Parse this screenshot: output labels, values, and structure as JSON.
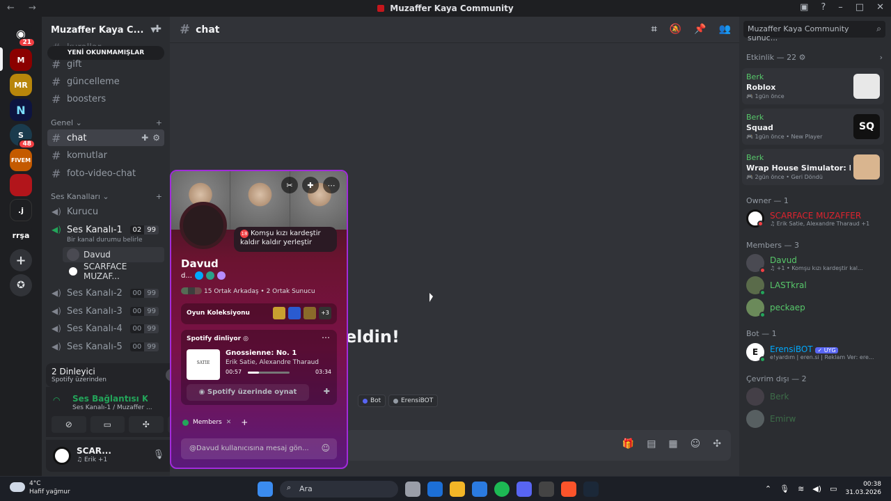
{
  "window": {
    "title": "Muzaffer Kaya Community",
    "nav": "← →"
  },
  "guilds": [
    {
      "label": "",
      "badge": "21",
      "color": "#1e1f22",
      "glyph": "🎮"
    },
    {
      "label": "M",
      "badge": "",
      "color": "#8b0000"
    },
    {
      "label": "MR",
      "badge": "",
      "color": "#b8860b"
    },
    {
      "label": "N",
      "badge": "",
      "color": "#0d1440"
    },
    {
      "label": "S",
      "badge": "48",
      "color": "#1a3b4d"
    },
    {
      "label": "FIVEM",
      "badge": "",
      "color": "#c45a00"
    },
    {
      "label": "",
      "badge": "",
      "color": "#b2151b"
    },
    {
      "label": ".j",
      "badge": "",
      "color": "#1e1f22"
    },
    {
      "label": "rrşa",
      "badge": "",
      "color": "#1e1f22"
    }
  ],
  "server": {
    "name": "Muzaffer Kaya C...",
    "unread": "YENİ OKUNMAMIŞLAR"
  },
  "channels_top": [
    "kurallar",
    "gift",
    "güncelleme",
    "boosters"
  ],
  "category_general": "Genel",
  "channels_general": [
    "chat",
    "komutlar",
    "foto-video-chat"
  ],
  "category_voice": "Ses Kanalları",
  "voice": [
    {
      "name": "Kurucu"
    },
    {
      "name": "Ses Kanalı-1",
      "count": "02",
      "max": "99",
      "status": "Bir kanal durumu belirle"
    },
    {
      "name": "Ses Kanalı-2",
      "count": "00",
      "max": "99"
    },
    {
      "name": "Ses Kanalı-3",
      "count": "00",
      "max": "99"
    },
    {
      "name": "Ses Kanalı-4",
      "count": "00",
      "max": "99"
    },
    {
      "name": "Ses Kanalı-5",
      "count": "00",
      "max": "99"
    }
  ],
  "voice_users": [
    "Davud",
    "SCARFACE MUZAF..."
  ],
  "listeners": {
    "title": "2 Dinleyici",
    "sub": "Spotify üzerinden"
  },
  "connection": {
    "title": "Ses Bağlantısı Kurul",
    "sub": "Ses Kanalı-1 / Muzaffer ..."
  },
  "user": {
    "name": "SCAR...",
    "status": "Erik",
    "extra": "+1"
  },
  "channel_header": {
    "name": "chat",
    "search": "Muzaffer Kaya Community sunuc..."
  },
  "welcome": "eldin!",
  "tags": [
    {
      "label": "Bot",
      "color": "#5865f2"
    },
    {
      "label": "ErensiBOT",
      "color": "#949ba4"
    }
  ],
  "activity": {
    "header": "Etkinlik — 22",
    "items": [
      {
        "user": "Berk",
        "game": "Roblox",
        "meta": "1gün önce",
        "extra": ""
      },
      {
        "user": "Berk",
        "game": "Squad",
        "meta": "1gün önce",
        "extra": "New Player"
      },
      {
        "user": "Berk",
        "game": "Wrap House Simulator: Pro...",
        "meta": "2gün önce",
        "extra": "Geri Döndü"
      }
    ]
  },
  "groups": {
    "owner": "Owner — 1",
    "members": "Members — 3",
    "bot": "Bot — 1",
    "offline": "Çevrim dışı — 2"
  },
  "owner": {
    "name": "SCARFACE MUZAFFER",
    "sub": "Erik Satie, Alexandre Tharaud +1"
  },
  "member_list": [
    {
      "name": "Davud",
      "sub": "+1 • Komşu kızı kardeştir kal...",
      "color": "#57c86a"
    },
    {
      "name": "LASTkral",
      "sub": "",
      "color": "#57c86a"
    },
    {
      "name": "peckaep",
      "sub": "",
      "color": "#57c86a"
    }
  ],
  "bot": {
    "name": "ErensiBOT",
    "badge": "✓ UYG",
    "sub": "e!yardım | eren.si | Reklam Ver: ere..."
  },
  "offline_list": [
    "Berk",
    "Emirw"
  ],
  "popout": {
    "name": "Davud",
    "tag": "d...",
    "bubble_n": "18",
    "bubble": "Komşu kızı kardeştir kaldır kaldır yerleştir",
    "mutual": "15 Ortak Arkadaş • 2 Ortak Sunucu",
    "games_label": "Oyun Koleksiyonu",
    "games_more": "+3",
    "spotify_label": "Spotify dinliyor",
    "track": "Gnossienne: No. 1",
    "artist": "Erik Satie, Alexandre Tharaud",
    "elapsed": "00:57",
    "duration": "03:34",
    "progress": 0.27,
    "play_btn": "Spotify üzerinde oynat",
    "cover_text": "SATIE",
    "roles_label": "Members",
    "message_placeholder": "@Davud kullanıcısına mesaj gön..."
  },
  "taskbar": {
    "temp": "4°C",
    "weather": "Hafif yağmur",
    "search": "Ara",
    "time": "00:38",
    "date": "31.03.2026"
  }
}
